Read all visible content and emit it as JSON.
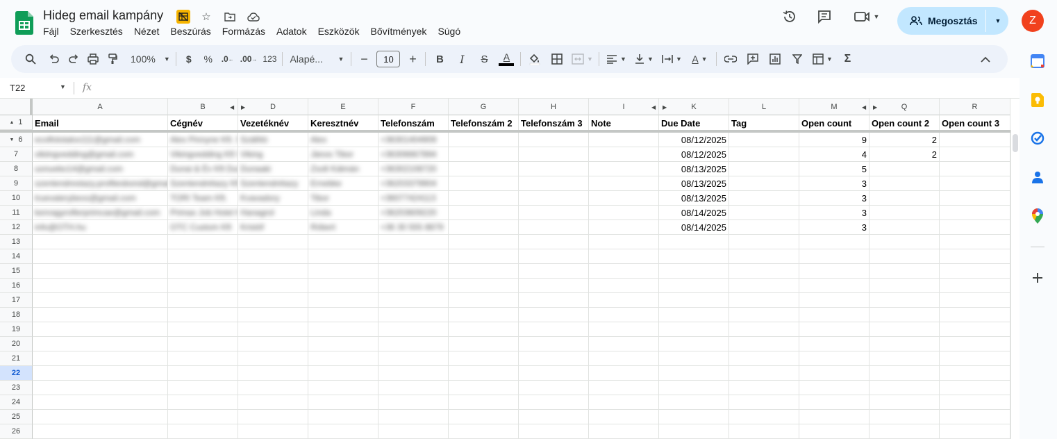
{
  "document": {
    "title": "Hideg email kampány"
  },
  "menu": [
    "Fájl",
    "Szerkesztés",
    "Nézet",
    "Beszúrás",
    "Formázás",
    "Adatok",
    "Eszközök",
    "Bővítmények",
    "Súgó"
  ],
  "share": {
    "label": "Megosztás"
  },
  "user": {
    "initial": "Z",
    "color": "#f1411d"
  },
  "toolbar": {
    "zoom": "100%",
    "currency": "$",
    "percent": "%",
    "dec_decrease": ".0",
    "dec_increase": ".00",
    "format_123": "123",
    "font": "Alapé...",
    "font_size": "10",
    "minus": "−",
    "plus": "+",
    "bold": "B",
    "italic": "I",
    "strike": "S",
    "text_color_letter": "A",
    "text_rotation_letter": "A",
    "sigma": "Σ"
  },
  "formula_bar": {
    "cell_ref": "T22",
    "fx": "fx"
  },
  "columns": [
    {
      "letter": "A",
      "header": "Email"
    },
    {
      "letter": "B",
      "header": "Cégnév"
    },
    {
      "letter": "D",
      "header": "Vezetéknév"
    },
    {
      "letter": "E",
      "header": "Keresztnév"
    },
    {
      "letter": "F",
      "header": "Telefonszám"
    },
    {
      "letter": "G",
      "header": "Telefonszám 2"
    },
    {
      "letter": "H",
      "header": "Telefonszám 3"
    },
    {
      "letter": "I",
      "header": "Note"
    },
    {
      "letter": "K",
      "header": "Due Date"
    },
    {
      "letter": "L",
      "header": "Tag"
    },
    {
      "letter": "M",
      "header": "Open count"
    },
    {
      "letter": "Q",
      "header": "Open count 2"
    },
    {
      "letter": "R",
      "header": "Open count 3"
    }
  ],
  "data_rows": [
    {
      "row": "6",
      "email": "ecolfolotalox111@gmail.com",
      "company": "Alex Pinnyne Kft. Szállító",
      "last": "Szállító",
      "first": "Alex",
      "phone": "+36301404909",
      "due": "08/12/2025",
      "open1": "9",
      "open2": "2"
    },
    {
      "row": "7",
      "email": "vikiingvedding@gmail.com",
      "company": "Vikingvedding Kft Viking",
      "last": "Viking",
      "first": "János Tibor",
      "phone": "+36306667894",
      "due": "08/12/2025",
      "open1": "4",
      "open2": "2"
    },
    {
      "row": "8",
      "email": "uonuebo14@gmail.com",
      "company": "Dunai & Év Kft Dunaaki",
      "last": "Dunaaki",
      "first": "Zsolt Kálmán",
      "phone": "+36302108720",
      "due": "08/13/2025",
      "open1": "5",
      "open2": ""
    },
    {
      "row": "9",
      "email": "szentendrestazy.profitesbond@gmail.com",
      "company": "Szentendrétazy Kft",
      "last": "Szentendrétazy",
      "first": "Ernebke",
      "phone": "+36203379904",
      "due": "08/13/2025",
      "open1": "3",
      "open2": ""
    },
    {
      "row": "10",
      "email": "truevaterybexs@gmail.com",
      "company": "TORI Team Kft.",
      "last": "Kvavadory",
      "first": "Tibor",
      "phone": "+36077424113",
      "due": "08/13/2025",
      "open1": "3",
      "open2": ""
    },
    {
      "row": "11",
      "email": "kenragyrofterprimcae@gmail.com",
      "company": "Primax Job Hotel Hanagrol Tdk",
      "last": "Hanagrol",
      "first": "Linda",
      "phone": "+36203609220",
      "due": "08/14/2025",
      "open1": "3",
      "open2": ""
    },
    {
      "row": "12",
      "email": "info@OTH.hu",
      "company": "OTC Custom Kft",
      "last": "Kristóf",
      "first": "Róbert",
      "phone": "+36 30 555 8879",
      "due": "08/14/2025",
      "open1": "3",
      "open2": ""
    }
  ],
  "empty_rows": [
    "13",
    "14",
    "15",
    "16",
    "17",
    "18",
    "19",
    "20",
    "21",
    "22",
    "23",
    "24",
    "25",
    "26"
  ],
  "selected_row": "22",
  "header_row_number": "1"
}
